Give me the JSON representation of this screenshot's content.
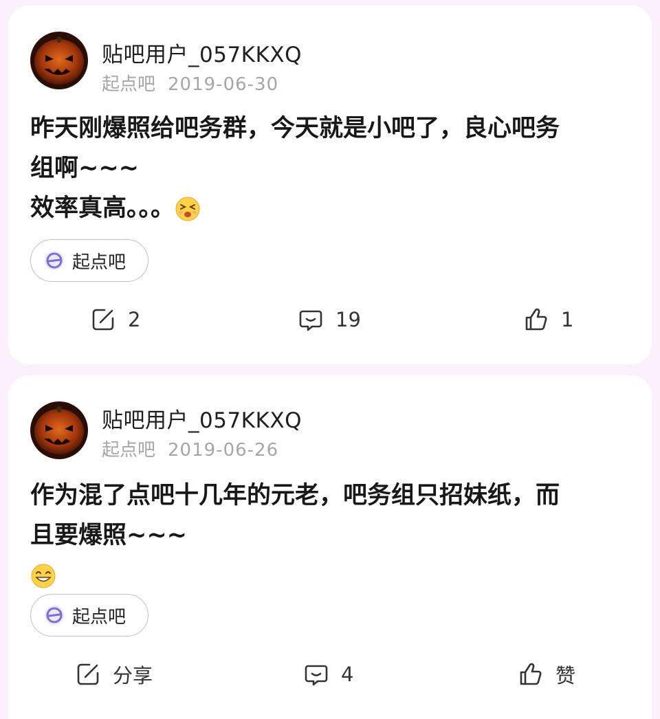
{
  "posts": [
    {
      "username": "贴吧用户_057KKXQ",
      "forum": "起点吧",
      "date": "2019-06-30",
      "content_lines": [
        "昨天刚爆照给吧务群，今天就是小吧了，良心吧务",
        "组啊~~~",
        "效率真高。。。"
      ],
      "emoji": "laughing-emoji",
      "tag_label": "起点吧",
      "actions": {
        "share": "2",
        "comment": "19",
        "like": "1"
      }
    },
    {
      "username": "贴吧用户_057KKXQ",
      "forum": "起点吧",
      "date": "2019-06-26",
      "content_lines": [
        "作为混了点吧十几年的元老，吧务组只招妹纸，而",
        "且要爆照~~~"
      ],
      "emoji": "smiling-emoji",
      "tag_label": "起点吧",
      "actions": {
        "share": "分享",
        "comment": "4",
        "like": "赞"
      }
    }
  ],
  "colors": {
    "background": "#fbf0fb",
    "card": "#ffffff",
    "meta_text": "#a6a6a6",
    "tag_icon": "#7b6fd6"
  }
}
